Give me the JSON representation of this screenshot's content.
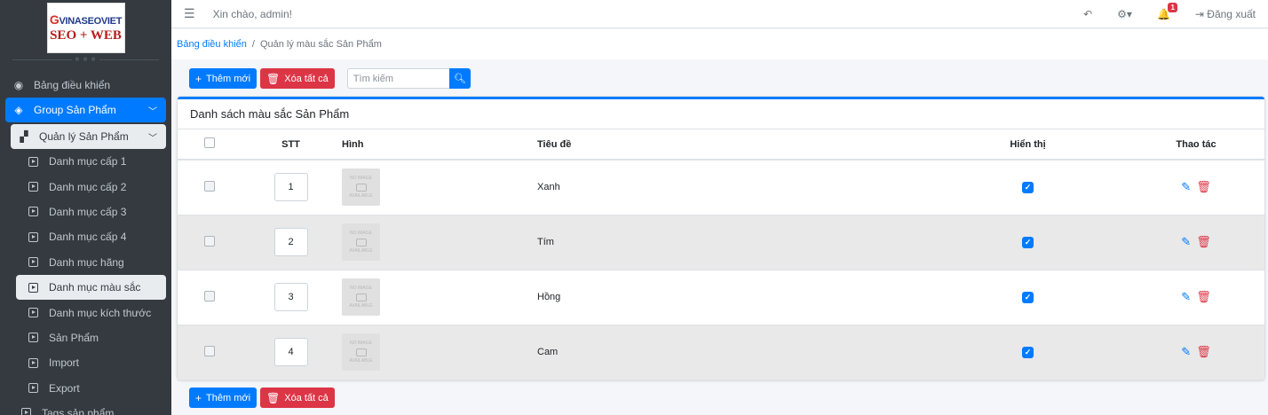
{
  "logo": {
    "top": "VINASEOVIET",
    "g": "G",
    "bottom": "SEO + WEB"
  },
  "sidebar": {
    "dashboard": "Bảng điều khiển",
    "group": "Group Sản Phẩm",
    "manage": "Quản lý Sản Phẩm",
    "items": [
      "Danh mục cấp 1",
      "Danh mục cấp 2",
      "Danh mục cấp 3",
      "Danh mục cấp 4",
      "Danh mục hãng",
      "Danh mục màu sắc",
      "Danh mục kích thước",
      "Sản Phẩm",
      "Import",
      "Export"
    ],
    "tags": "Tags sản phẩm"
  },
  "topbar": {
    "greeting": "Xin chào, admin!",
    "notif_count": "1",
    "logout": "Đăng xuất"
  },
  "breadcrumb": {
    "home": "Bảng điều khiển",
    "sep": "/",
    "current": "Quản lý màu sắc Sản Phẩm"
  },
  "toolbar": {
    "add": "Thêm mới",
    "delete_all": "Xóa tất cả",
    "search_placeholder": "Tìm kiếm"
  },
  "card": {
    "title": "Danh sách màu sắc Sản Phẩm"
  },
  "table": {
    "headers": {
      "stt": "STT",
      "image": "Hình",
      "title": "Tiêu đề",
      "show": "Hiển thị",
      "actions": "Thao tác"
    },
    "noimage": {
      "line1": "NO IMAGE",
      "line2": "AVAILABLE"
    },
    "rows": [
      {
        "stt": "1",
        "title": "Xanh",
        "show": true
      },
      {
        "stt": "2",
        "title": "Tím",
        "show": true
      },
      {
        "stt": "3",
        "title": "Hồng",
        "show": true
      },
      {
        "stt": "4",
        "title": "Cam",
        "show": true
      }
    ]
  },
  "colors": {
    "primary": "#007bff",
    "danger": "#dc3545",
    "sidebar": "#343a40"
  }
}
